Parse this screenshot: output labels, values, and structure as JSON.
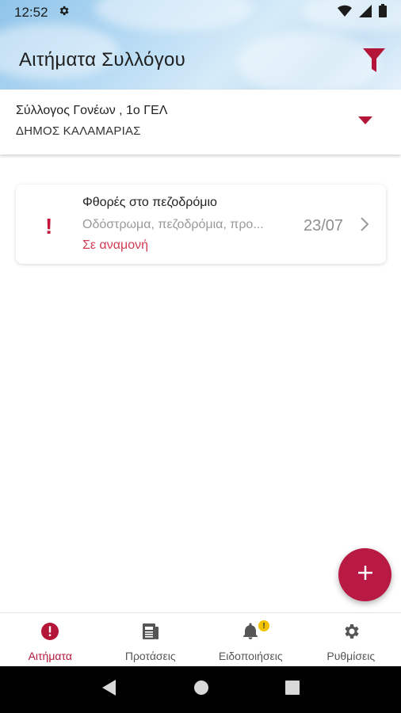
{
  "status_bar": {
    "time": "12:52"
  },
  "appbar": {
    "title": "Αιτήματα Συλλόγου"
  },
  "selector": {
    "line1": "Σύλλογος Γονέων , 1ο ΓΕΛ",
    "line2": "ΔΗΜΟΣ ΚΑΛΑΜΑΡΙΑΣ"
  },
  "requests": [
    {
      "alert_icon": "!",
      "title": "Φθορές στο πεζοδρόμιο",
      "description": "Οδόστρωμα, πεζοδρόμια, προ...",
      "status": "Σε αναμονή",
      "date": "23/07"
    }
  ],
  "bottom_nav": {
    "items": [
      {
        "label": "Αιτήματα",
        "icon": "alert-circle-icon",
        "active": true
      },
      {
        "label": "Προτάσεις",
        "icon": "newspaper-icon",
        "active": false
      },
      {
        "label": "Ειδοποιήσεις",
        "icon": "bell-icon",
        "active": false,
        "badge": "!"
      },
      {
        "label": "Ρυθμίσεις",
        "icon": "gear-icon",
        "active": false
      }
    ]
  },
  "colors": {
    "accent": "#b4163a",
    "fab": "#b81a43",
    "badge": "#f2c300"
  }
}
